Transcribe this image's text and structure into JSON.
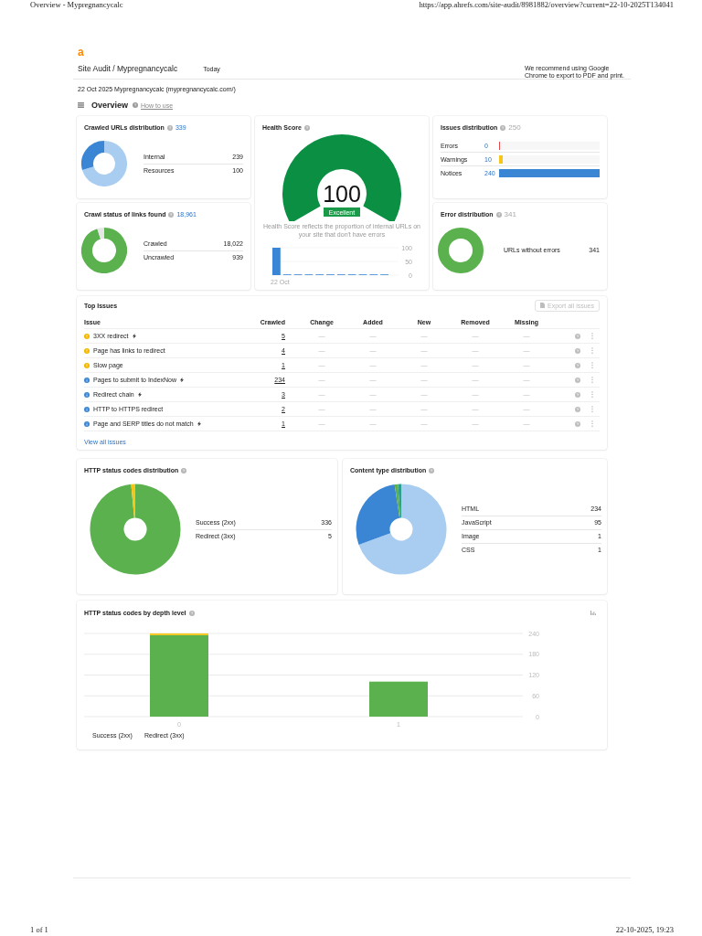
{
  "print_header": {
    "title": "Overview - Mypregnancycalc",
    "url": "https://app.ahrefs.com/site-audit/8981882/overview?current=22-10-2025T134041"
  },
  "app": {
    "logo": "a",
    "breadcrumb": "Site Audit / Mypregnancycalc",
    "period": "Today",
    "notice": "We recommend using Google Chrome to export to PDF and print."
  },
  "project_line": "22 Oct 2025 Mypregnancycalc (mypregnancycalc.com/)",
  "page_heading": {
    "title": "Overview",
    "help_link": "How to use"
  },
  "crawled_urls": {
    "title": "Crawled URLs distribution",
    "total": "339",
    "items": [
      {
        "label": "Internal",
        "value": "239",
        "color": "#a9cdf0"
      },
      {
        "label": "Resources",
        "value": "100",
        "color": "#3a86d4"
      }
    ]
  },
  "health_score": {
    "title": "Health Score",
    "score": "100",
    "level": 1,
    "rating": "Excellent",
    "description": "Health Score reflects the proportion of internal URLs on your site that don't have errors",
    "trend": {
      "axis_labels": [
        "100",
        "50",
        "0"
      ],
      "date_label": "22 Oct"
    }
  },
  "issues_distribution": {
    "title": "Issues distribution",
    "total": "250",
    "items": [
      {
        "label": "Errors",
        "value": "0",
        "level": 0
      },
      {
        "label": "Warnings",
        "value": "10",
        "color": "#f5c518",
        "level": 0.04
      },
      {
        "label": "Notices",
        "value": "240",
        "color": "#3a86d4",
        "level": 1
      }
    ]
  },
  "crawl_status": {
    "title": "Crawl status of links found",
    "total": "18,961",
    "items": [
      {
        "label": "Crawled",
        "value": "18,022",
        "color": "#5ab14e"
      },
      {
        "label": "Uncrawled",
        "value": "939",
        "color": "#e6e6e6"
      }
    ]
  },
  "error_distribution": {
    "title": "Error distribution",
    "total": "341",
    "items": [
      {
        "label": "URLs without errors",
        "value": "341",
        "color": "#5ab14e"
      }
    ]
  },
  "top_issues": {
    "title": "Top Issues",
    "export_button": {
      "label": "Export all issues",
      "disabled": true
    },
    "columns": [
      "Issue",
      "Crawled",
      "Change",
      "Added",
      "New",
      "Removed",
      "Missing"
    ],
    "rows": [
      {
        "kind": "warning",
        "issue": "3XX redirect",
        "bolt": true,
        "crawled": "5",
        "change": "—",
        "added": "—",
        "new": "—",
        "removed": "—",
        "missing": "—"
      },
      {
        "kind": "warning",
        "issue": "Page has links to redirect",
        "bolt": false,
        "crawled": "4",
        "change": "—",
        "added": "—",
        "new": "—",
        "removed": "—",
        "missing": "—"
      },
      {
        "kind": "warning",
        "issue": "Slow page",
        "bolt": false,
        "crawled": "1",
        "change": "—",
        "added": "—",
        "new": "—",
        "removed": "—",
        "missing": "—"
      },
      {
        "kind": "notice",
        "issue": "Pages to submit to IndexNow",
        "bolt": true,
        "crawled": "234",
        "change": "—",
        "added": "—",
        "new": "—",
        "removed": "—",
        "missing": "—"
      },
      {
        "kind": "notice",
        "issue": "Redirect chain",
        "bolt": true,
        "crawled": "3",
        "change": "—",
        "added": "—",
        "new": "—",
        "removed": "—",
        "missing": "—"
      },
      {
        "kind": "notice",
        "issue": "HTTP to HTTPS redirect",
        "bolt": false,
        "crawled": "2",
        "change": "—",
        "added": "—",
        "new": "—",
        "removed": "—",
        "missing": "—"
      },
      {
        "kind": "notice",
        "issue": "Page and SERP titles do not match",
        "bolt": true,
        "crawled": "1",
        "change": "—",
        "added": "—",
        "new": "—",
        "removed": "—",
        "missing": "—"
      }
    ],
    "view_all": "View all issues"
  },
  "http_status": {
    "title": "HTTP status codes distribution",
    "items": [
      {
        "label": "Success (2xx)",
        "value": "336",
        "color": "#5ab14e"
      },
      {
        "label": "Redirect (3xx)",
        "value": "5",
        "color": "#f5c518"
      }
    ]
  },
  "content_types": {
    "title": "Content type distribution",
    "items": [
      {
        "label": "HTML",
        "value": "234",
        "color": "#a9cdf0"
      },
      {
        "label": "JavaScript",
        "value": "95",
        "color": "#3a86d4"
      },
      {
        "label": "Image",
        "value": "1",
        "color": "#5ab14e"
      },
      {
        "label": "CSS",
        "value": "1",
        "color": "#2e9e8f"
      }
    ]
  },
  "depth_chart": {
    "title": "HTTP status codes by depth level",
    "chart_data": {
      "type": "bar",
      "categories": [
        "0",
        "1"
      ],
      "series": [
        {
          "name": "Success (2xx)",
          "color": "#5ab14e",
          "values": [
            235,
            101
          ]
        },
        {
          "name": "Redirect (3xx)",
          "color": "#f5c518",
          "values": [
            5,
            0
          ]
        }
      ],
      "ylim": [
        0,
        240
      ],
      "yticks": [
        0,
        60,
        120,
        180,
        240
      ],
      "grid": true,
      "stacked": true
    }
  },
  "footer": {
    "page_count": "1 of 1",
    "printed": "22-10-2025, 19:23"
  }
}
